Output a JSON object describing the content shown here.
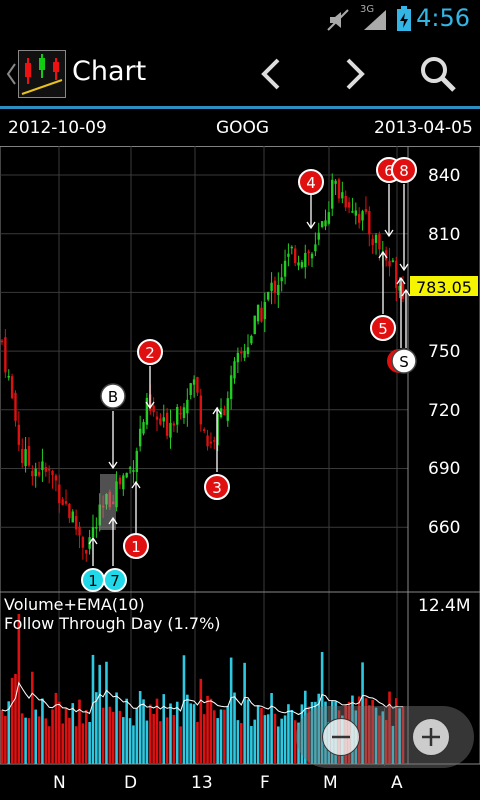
{
  "status": {
    "time": "4:56",
    "network": "3G"
  },
  "actionbar": {
    "title": "Chart"
  },
  "info": {
    "start_date": "2012-10-09",
    "symbol": "GOOG",
    "end_date": "2013-04-05"
  },
  "price_axis": {
    "labels": [
      "840",
      "810",
      "750",
      "720",
      "690",
      "660"
    ],
    "last_price": "783.05",
    "last_price_color": "#f5f500"
  },
  "volume": {
    "title": "Volume+EMA(10)",
    "subtitle": "Follow Through Day (1.7%)",
    "max_label": "12.4M"
  },
  "x_axis": {
    "labels": [
      "N",
      "D",
      "13",
      "F",
      "M",
      "A"
    ]
  },
  "markers": {
    "m1a": "1",
    "m7": "7",
    "m1b": "1",
    "m2": "2",
    "m3": "3",
    "m4": "4",
    "m5": "5",
    "m6": "6",
    "m8": "8",
    "mB": "B",
    "mS": "S"
  },
  "colors": {
    "up": "#22cc22",
    "down": "#dd1111",
    "volume_up": "#2ec8e0",
    "accent": "#2d8ec4",
    "marker_red": "#e01010",
    "marker_cyan": "#20d8e8"
  },
  "chart_data": {
    "type": "candlestick",
    "title": "GOOG",
    "x": [
      "2012-10-09",
      "2013-04-05"
    ],
    "ylim": [
      640,
      855
    ],
    "approx_close_path": [
      [
        "2012-10-09",
        755
      ],
      [
        "2012-10-18",
        695
      ],
      [
        "2012-11-01",
        685
      ],
      [
        "2012-11-15",
        650
      ],
      [
        "2012-11-28",
        680
      ],
      [
        "2012-12-05",
        690
      ],
      [
        "2012-12-12",
        720
      ],
      [
        "2012-12-20",
        710
      ],
      [
        "2013-01-02",
        735
      ],
      [
        "2013-01-09",
        700
      ],
      [
        "2013-01-22",
        745
      ],
      [
        "2013-02-05",
        780
      ],
      [
        "2013-02-15",
        800
      ],
      [
        "2013-02-25",
        800
      ],
      [
        "2013-03-05",
        835
      ],
      [
        "2013-03-14",
        825
      ],
      [
        "2013-03-22",
        810
      ],
      [
        "2013-04-05",
        783.05
      ]
    ]
  }
}
